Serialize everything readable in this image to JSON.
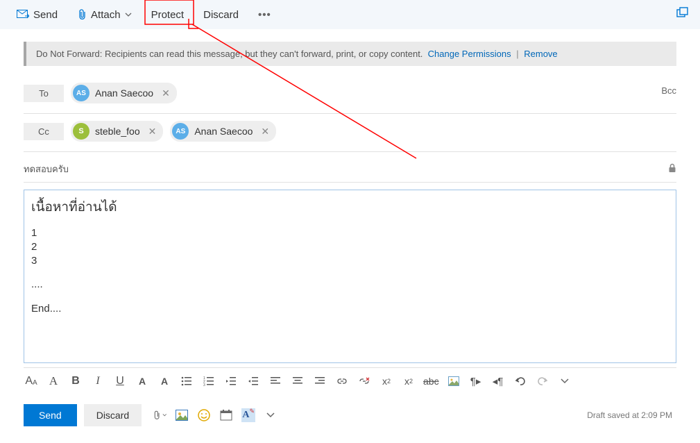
{
  "toolbar": {
    "send": "Send",
    "attach": "Attach",
    "protect": "Protect",
    "discard": "Discard"
  },
  "banner": {
    "text": "Do Not Forward: Recipients can read this message, but they can't forward, print, or copy content.",
    "change": "Change Permissions",
    "remove": "Remove"
  },
  "recipients": {
    "to_label": "To",
    "cc_label": "Cc",
    "bcc_label": "Bcc",
    "to": [
      {
        "initials": "AS",
        "name": "Anan Saecoo",
        "color": "blue"
      }
    ],
    "cc": [
      {
        "initials": "S",
        "name": "steble_foo",
        "color": "green"
      },
      {
        "initials": "AS",
        "name": "Anan Saecoo",
        "color": "blue"
      }
    ]
  },
  "subject": "ทดสอบครับ",
  "body": {
    "heading": "เนื้อหาที่อ่านได้",
    "lines": [
      "1",
      "2",
      "3"
    ],
    "dots": "....",
    "end": "End...."
  },
  "bottom": {
    "send": "Send",
    "discard": "Discard",
    "status": "Draft saved at 2:09 PM"
  },
  "fmt": {
    "abc": "abc"
  }
}
